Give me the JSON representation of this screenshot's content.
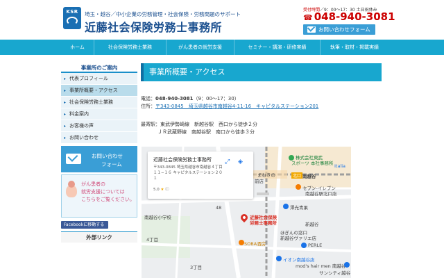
{
  "header": {
    "logo_text": "KSR",
    "tagline": "埼玉・越谷／中小企業の労務管理・社会保険・労務問題のサポート",
    "brand": "近藤社会保険労務士事務所",
    "hours_label": "受付時間",
    "hours_text": "／9：00〜17：30 土日祝休み",
    "phone": "048-940-3081",
    "contact_button": "お問い合わせフォーム"
  },
  "nav": {
    "items": [
      {
        "label": "ホーム"
      },
      {
        "label": "社会保険労務士業務"
      },
      {
        "label": "がん患者の就労支援"
      },
      {
        "label": "セミナー・講演・研修実績"
      },
      {
        "label": "執筆・取材・掲載実績"
      }
    ]
  },
  "sidebar": {
    "heading": "事業所のご案内",
    "items": [
      {
        "label": "代表プロフィール",
        "active": false
      },
      {
        "label": "事業所概要・アクセス",
        "active": true
      },
      {
        "label": "社会保険労務士業務",
        "active": false
      },
      {
        "label": "料金案内",
        "active": false
      },
      {
        "label": "お客様の声",
        "active": false
      },
      {
        "label": "お問い合わせ",
        "active": false
      }
    ],
    "cta_line1": "お問い合わせ",
    "cta_line2": "フォーム",
    "banner_line1": "がん患者の",
    "banner_line2": "就労支援については",
    "banner_line3": "こちらをご覧ください。",
    "facebook": "Facebookに移動する",
    "external_heading": "外部リンク"
  },
  "main": {
    "page_title": "事業所概要・アクセス",
    "tel_label": "電話：",
    "tel": "048-940-3081",
    "tel_hours": "（9：00～17：30）",
    "address_label": "住所：",
    "address": "〒343-0845　埼玉県越谷市南越谷4-11-16　キャピタルステーション201",
    "station_label": "最寄駅：",
    "station1": "東武伊勢崎線　新越谷駅　西口から徒歩２分",
    "station2": "ＪＲ武蔵野線　南越谷駅　南口から徒歩３分"
  },
  "map": {
    "card_name": "近藤社会保険労務士事務所",
    "card_address": "〒343-0845 埼玉県越谷市南越谷４丁目１１−１６ キャピタルステーション２０１",
    "card_rating": "5.0",
    "pin_label_1": "近藤社会保険",
    "pin_label_2": "労務士事務所",
    "labels": {
      "school": "南越谷小学校",
      "store1": "株式会社東武",
      "store2": "スポーツ 本社事務所",
      "station": "南越谷",
      "exit": "北口",
      "seven": "セブン-イレブン",
      "seven2": "南越谷駅北口店",
      "pharmacy": "澤光青果",
      "soba": "SOBA酒房",
      "perle": "PERLE",
      "mods": "mod's hair men 南越谷",
      "aeon": "イオン南越谷店",
      "sunshine": "サンシティ越谷",
      "shinkoshigaya": "新越谷",
      "hotori": "ほぎんの窓口",
      "hotori2": "新越谷ヴァリエ店",
      "ekimae": "前店",
      "italia": "Italia",
      "hall": "まねきの",
      "road4": "4丁目",
      "road3": "3丁目",
      "num48": "48"
    }
  }
}
